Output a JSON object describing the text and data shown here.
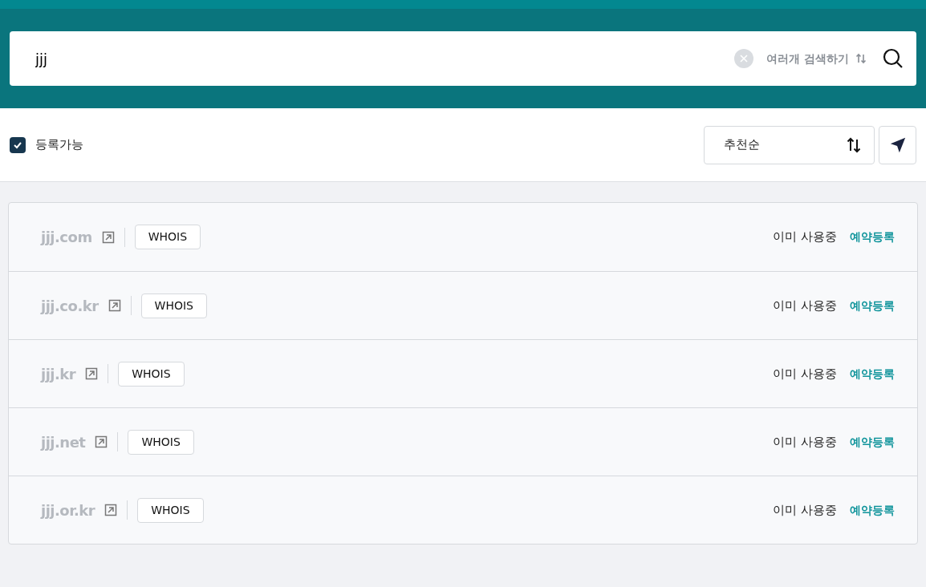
{
  "search": {
    "value": "jjj",
    "multi_search_label": "여러개 검색하기"
  },
  "filter": {
    "label": "등록가능",
    "checked": true
  },
  "sort": {
    "label": "추천순"
  },
  "results": [
    {
      "domain": "jjj.com",
      "whois": "WHOIS",
      "status": "이미 사용중",
      "action": "예약등록"
    },
    {
      "domain": "jjj.co.kr",
      "whois": "WHOIS",
      "status": "이미 사용중",
      "action": "예약등록"
    },
    {
      "domain": "jjj.kr",
      "whois": "WHOIS",
      "status": "이미 사용중",
      "action": "예약등록"
    },
    {
      "domain": "jjj.net",
      "whois": "WHOIS",
      "status": "이미 사용중",
      "action": "예약등록"
    },
    {
      "domain": "jjj.or.kr",
      "whois": "WHOIS",
      "status": "이미 사용중",
      "action": "예약등록"
    }
  ]
}
